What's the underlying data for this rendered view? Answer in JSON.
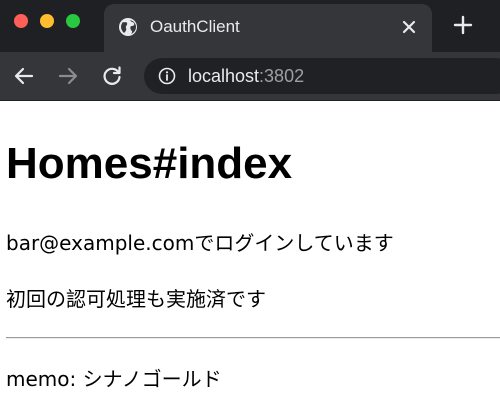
{
  "browser": {
    "tab": {
      "title": "OauthClient",
      "icon": "globe-icon"
    },
    "toolbar": {
      "url_host": "localhost",
      "url_port": ":3802"
    },
    "colors": {
      "tabstrip_bg": "#1f2023",
      "active_tab_bg": "#35363a",
      "omnibox_bg": "#202124",
      "close_red": "#fe5f57",
      "minimize_yellow": "#febc2e",
      "zoom_green": "#28c840"
    }
  },
  "page": {
    "title": "Homes#index",
    "login_status": "bar@example.comでログインしています",
    "authorization_note": "初回の認可処理も実施済です",
    "memo": "memo: シナノゴールド"
  }
}
